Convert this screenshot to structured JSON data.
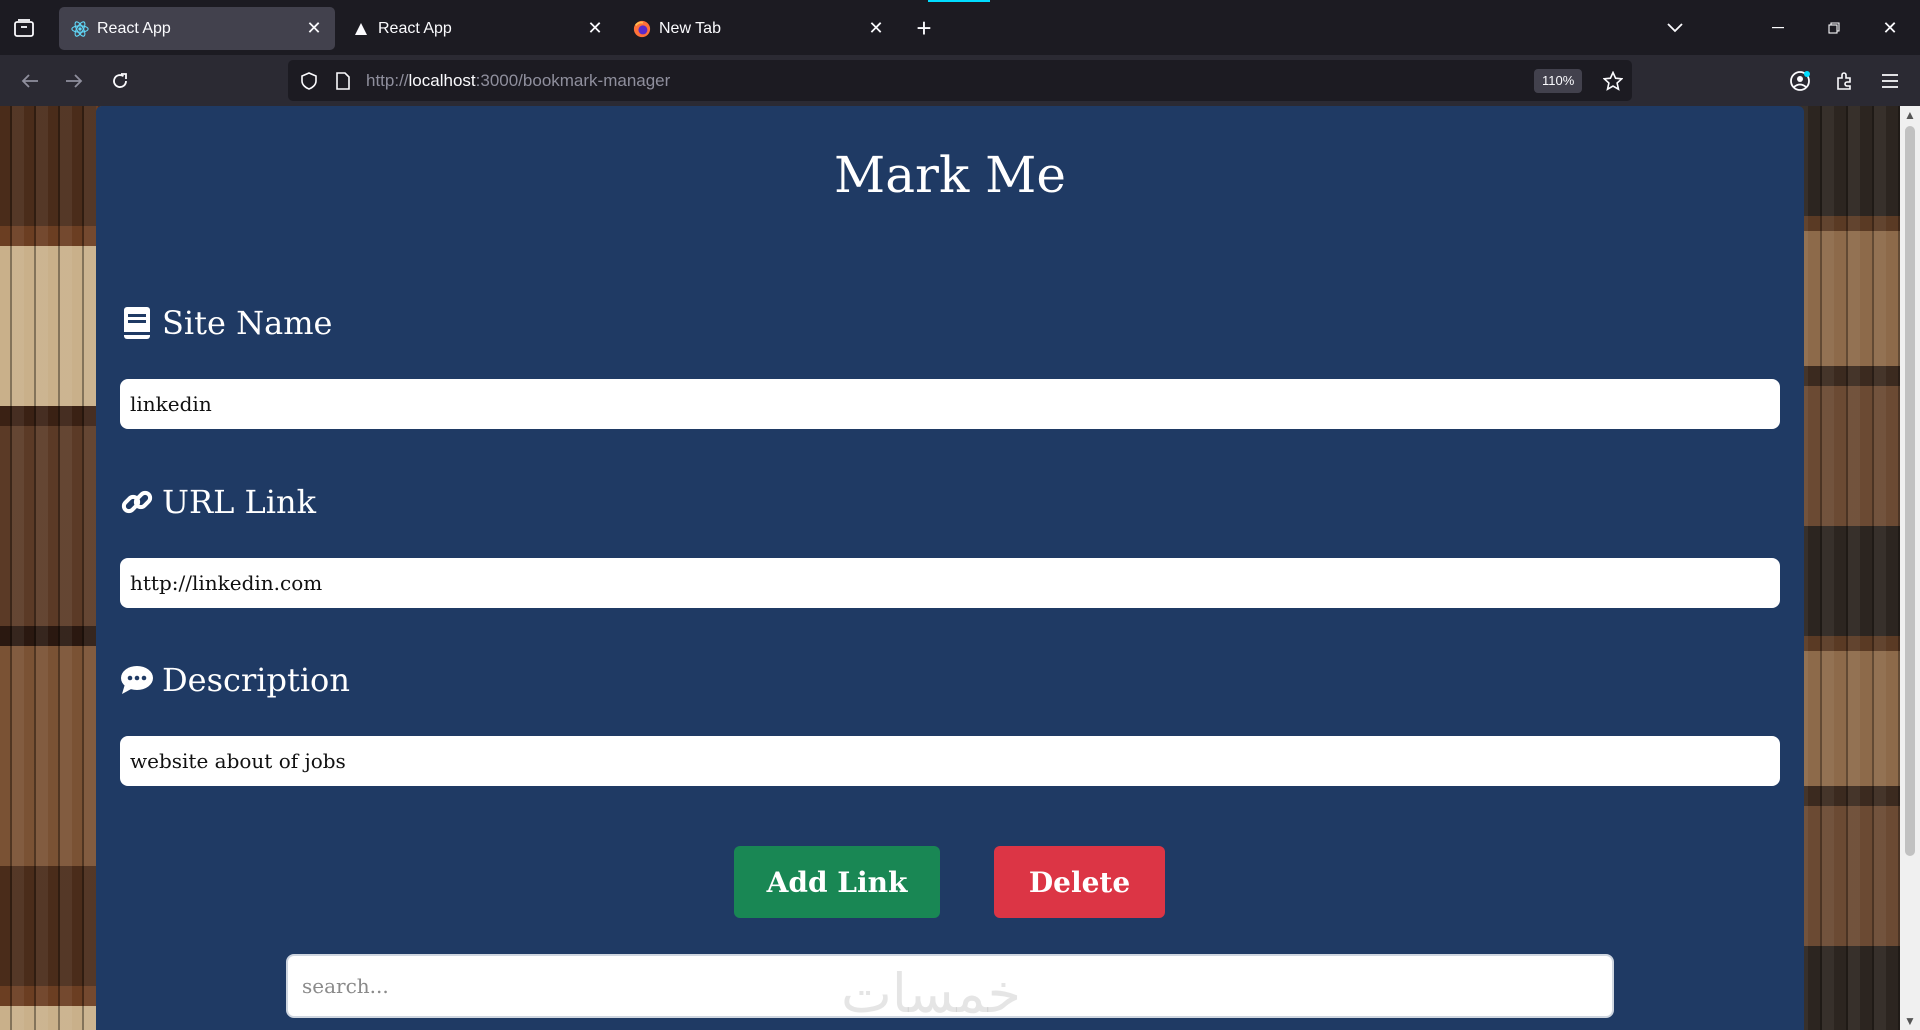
{
  "browser": {
    "tabs": [
      {
        "title": "React App",
        "favicon": "react-icon",
        "active": true
      },
      {
        "title": "React App",
        "favicon": "triangle-icon",
        "active": false
      },
      {
        "title": "New Tab",
        "favicon": "firefox-icon",
        "active": false
      }
    ],
    "url": {
      "scheme": "http://",
      "host": "localhost",
      "rest": ":3000/bookmark-manager"
    },
    "zoom": "110%"
  },
  "app": {
    "title": "Mark Me",
    "fields": [
      {
        "label": "Site Name",
        "icon": "book-icon",
        "value": "linkedin"
      },
      {
        "label": "URL Link",
        "icon": "link-icon",
        "value": "http://linkedin.com"
      },
      {
        "label": "Description",
        "icon": "comment-icon",
        "value": "website about of jobs"
      }
    ],
    "buttons": {
      "add": "Add Link",
      "delete": "Delete"
    },
    "search": {
      "placeholder": "search..."
    },
    "watermark": "خمسات"
  },
  "colors": {
    "card": "#1f3a64",
    "add_button": "#198754",
    "delete_button": "#dc3545"
  }
}
